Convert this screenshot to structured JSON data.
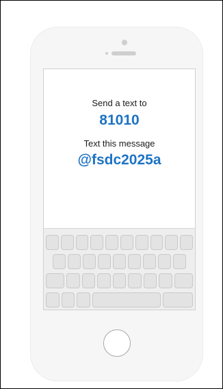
{
  "instructions": {
    "send_label": "Send a text to",
    "number": "81010",
    "message_label": "Text this message",
    "code": "@fsdc2025a"
  },
  "colors": {
    "accent": "#1e73c4",
    "phone_body": "#f6f6f6",
    "key": "#e3e3e3"
  },
  "keyboard": {
    "rows": [
      {
        "keys": 10
      },
      {
        "keys": 9
      },
      {
        "keys": 9,
        "wide_ends": true
      },
      {
        "keys": 5,
        "has_space_bar": true
      }
    ]
  },
  "icons": [
    "home-button-icon",
    "camera-dot-icon",
    "speaker-icon"
  ]
}
